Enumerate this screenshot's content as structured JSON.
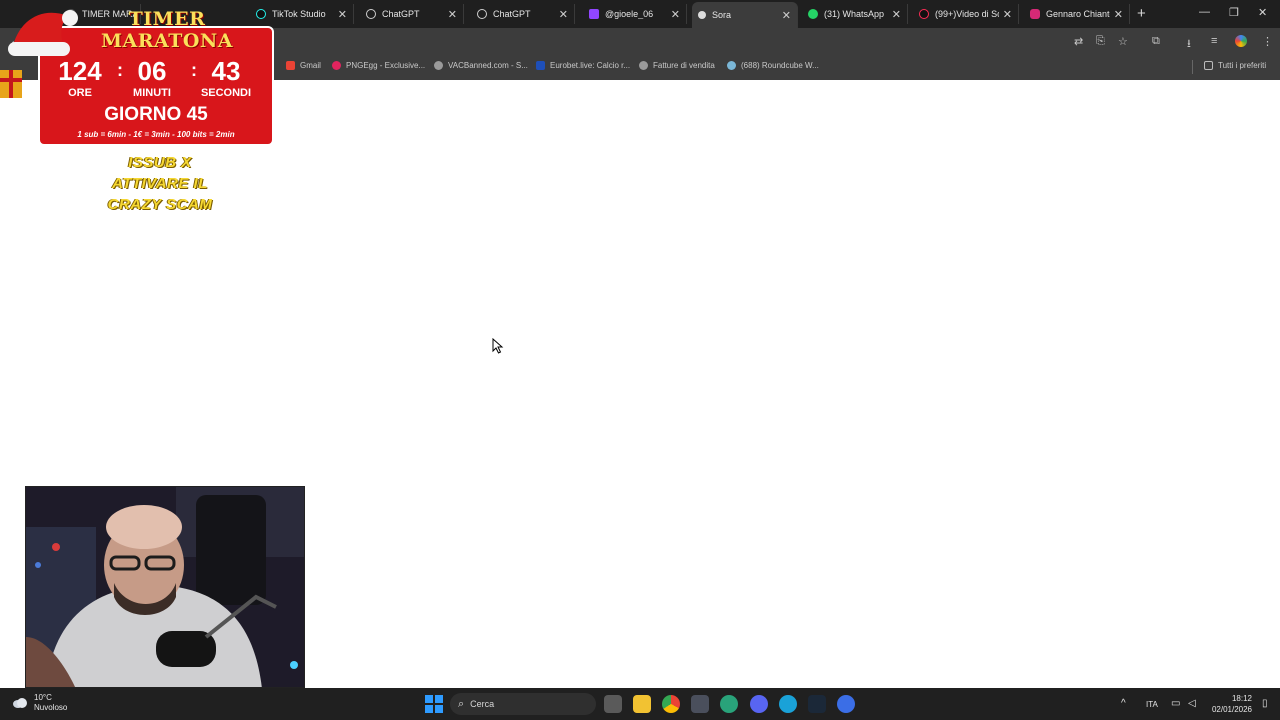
{
  "browser": {
    "tabs": [
      {
        "title": "TIMER MARATONA",
        "icon": "stream-icon",
        "active": false
      },
      {
        "title": "TikTok Studio",
        "icon": "tiktok-icon",
        "active": false
      },
      {
        "title": "ChatGPT",
        "icon": "chatgpt-icon",
        "active": false
      },
      {
        "title": "ChatGPT",
        "icon": "chatgpt-icon",
        "active": false
      },
      {
        "title": "@gioele_06",
        "icon": "twitch-icon",
        "active": false
      },
      {
        "title": "Sora",
        "icon": "sora-icon",
        "active": true
      },
      {
        "title": "(31) WhatsApp",
        "icon": "whatsapp-icon",
        "active": false
      },
      {
        "title": "(99+)Video di Sc",
        "icon": "tiktok-icon",
        "active": false
      },
      {
        "title": "Gennaro Chiante",
        "icon": "instagram-icon",
        "active": false
      }
    ],
    "bookmarks": [
      {
        "label": "Gmail",
        "icon": "gmail-icon",
        "color": "#ea4335"
      },
      {
        "label": "PNGEgg - Exclusive...",
        "icon": "pngegg-icon",
        "color": "#e0245e"
      },
      {
        "label": "VACBanned.com - S...",
        "icon": "globe-icon",
        "color": "#9a9a9a"
      },
      {
        "label": "Eurobet.live: Calcio r...",
        "icon": "eurobet-icon",
        "color": "#1e4fb8"
      },
      {
        "label": "Fatture di vendita",
        "icon": "globe-icon",
        "color": "#9a9a9a"
      },
      {
        "label": "(688) Roundcube W...",
        "icon": "roundcube-icon",
        "color": "#7ab6d6"
      }
    ],
    "all_bookmarks_label": "Tutti i preferiti"
  },
  "overlay": {
    "header": "TIMER MARATONA",
    "hours": "124",
    "minutes": "06",
    "seconds": "43",
    "hours_label": "ORE",
    "minutes_label": "MINUTI",
    "seconds_label": "SECONDI",
    "day": "GIORNO 45",
    "rates": "1 sub = 6min - 1€ = 3min - 100 bits = 2min",
    "promo_line1": "ISSUB X",
    "promo_line2": "ATTIVARE IL",
    "promo_line3": "CRAZY SCAM"
  },
  "taskbar": {
    "temperature": "10°C",
    "condition": "Nuvoloso",
    "search_label": "Cerca",
    "language": "ITA",
    "time": "18:12",
    "date": "02/01/2026"
  },
  "colors": {
    "tab_bg": "#1f1f1f",
    "toolbar_bg": "#3c3c3c",
    "overlay_red": "#d8161b",
    "overlay_yellow": "#f6d832",
    "taskbar_bg": "#202020"
  }
}
